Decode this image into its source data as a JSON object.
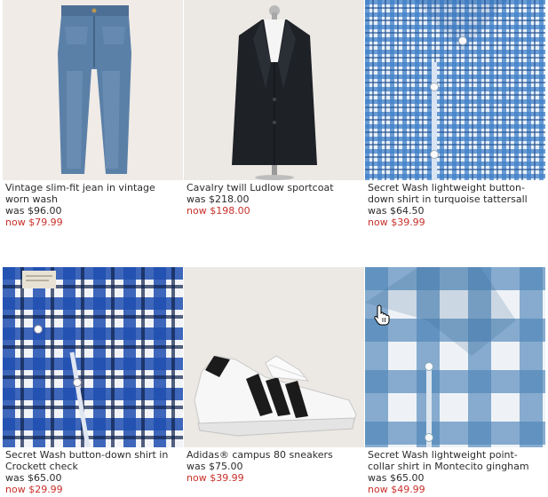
{
  "products": [
    {
      "name_lines": [
        "Vintage slim-fit jean in vintage",
        "worn wash"
      ],
      "was": "was $96.00",
      "now": "now $79.99",
      "image": "jeans-image"
    },
    {
      "name_lines": [
        "Cavalry twill Ludlow sportcoat"
      ],
      "was": "was $218.00",
      "now": "now $198.00",
      "image": "sportcoat-image"
    },
    {
      "name_lines": [
        "Secret Wash lightweight button-",
        "down shirt in turquoise tattersall"
      ],
      "was": "was $64.50",
      "now": "now $39.99",
      "image": "tattersall-shirt-image"
    },
    {
      "name_lines": [
        "Secret Wash button-down shirt in",
        "Crockett check"
      ],
      "was": "was $65.00",
      "now": "now $29.99",
      "image": "crockett-check-shirt-image"
    },
    {
      "name_lines": [
        "Adidas® campus 80 sneakers"
      ],
      "was": "was $75.00",
      "now": "now $39.99",
      "image": "sneakers-image"
    },
    {
      "name_lines": [
        "Secret Wash lightweight point-",
        "collar shirt in Montecito gingham"
      ],
      "was": "was $65.00",
      "now": "now $49.99",
      "image": "gingham-shirt-image"
    }
  ],
  "colors": {
    "price_now": "#c8302a",
    "text": "#2b2b2b"
  },
  "cursor_icon": "hand-pointer-icon"
}
